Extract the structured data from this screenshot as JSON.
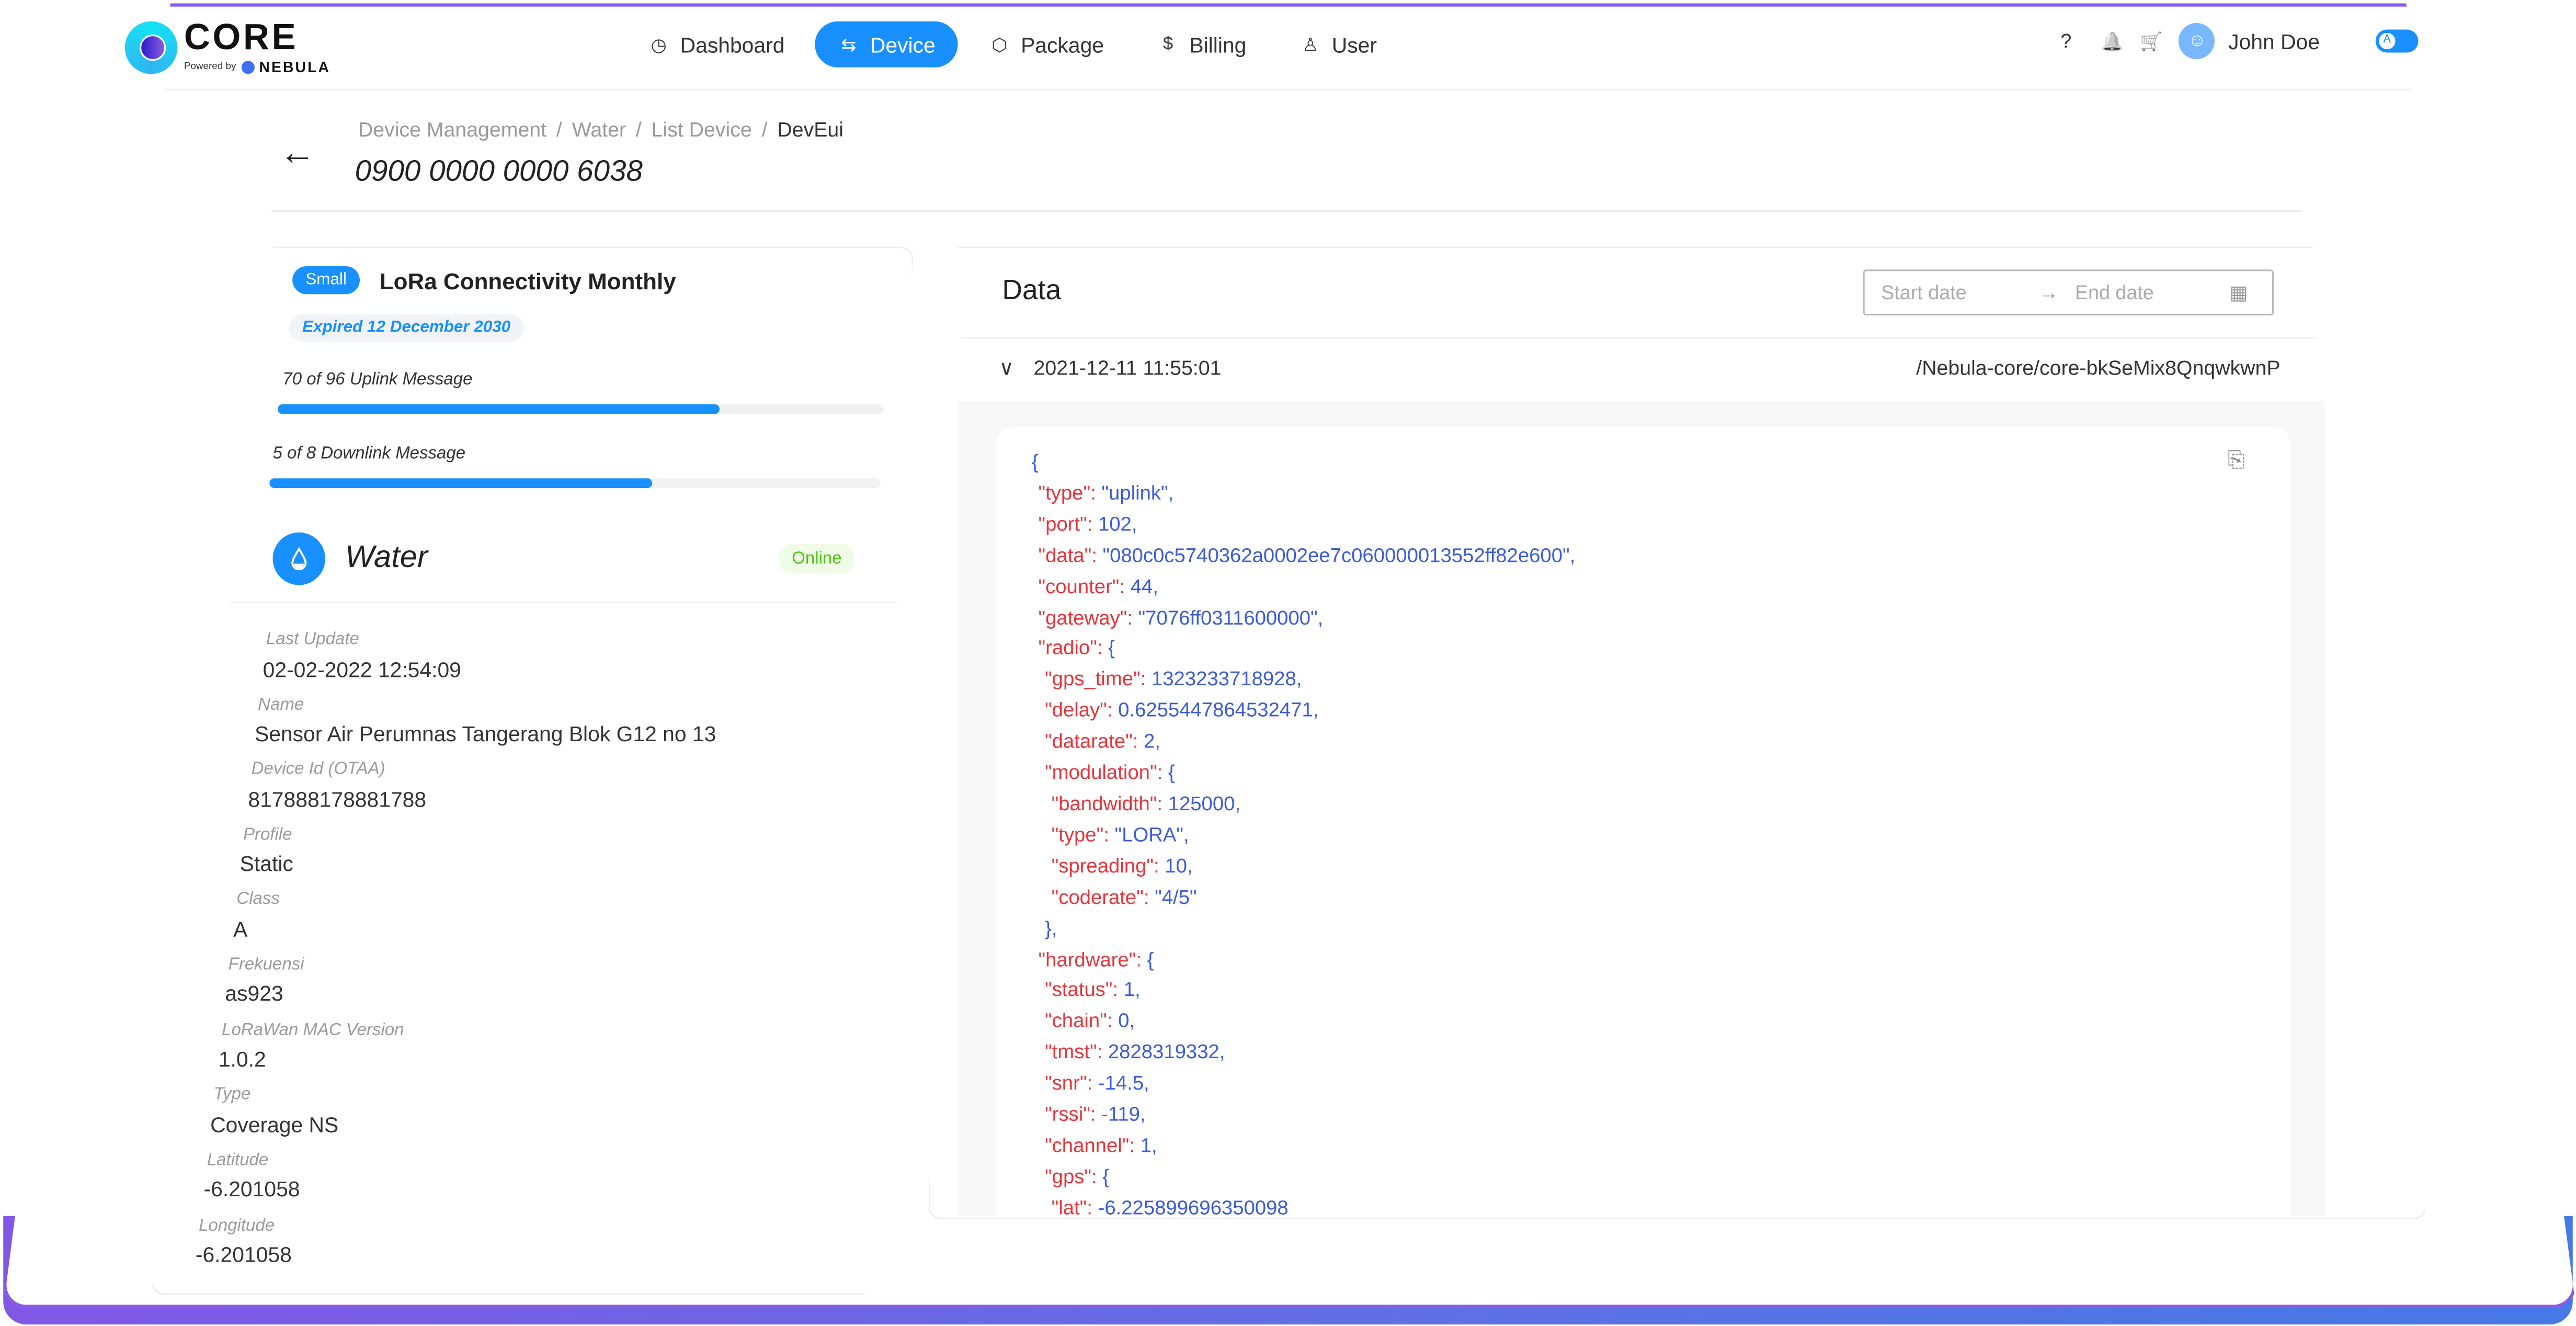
{
  "app": {
    "logo_title": "CORE",
    "logo_sub_prefix": "Powered by",
    "logo_sub_brand": "NEBULA"
  },
  "nav": {
    "items": [
      {
        "label": "Dashboard",
        "icon": "dashboard-icon",
        "glyph": "◷",
        "active": false
      },
      {
        "label": "Device",
        "icon": "device-icon",
        "glyph": "⇆",
        "active": true
      },
      {
        "label": "Package",
        "icon": "package-icon",
        "glyph": "⬡",
        "active": false
      },
      {
        "label": "Billing",
        "icon": "billing-icon",
        "glyph": "$",
        "active": false
      },
      {
        "label": "User",
        "icon": "user-icon",
        "glyph": "♙",
        "active": false
      }
    ]
  },
  "toolbar": {
    "help_glyph": "?",
    "bell_glyph": "🔔",
    "cart_glyph": "🛒",
    "user_name": "John Doe",
    "avatar_glyph": "☺",
    "language_toggle": "A"
  },
  "page": {
    "back_glyph": "←",
    "breadcrumb": [
      "Device Management",
      "Water",
      "List Device",
      "DevEui"
    ],
    "breadcrumb_sep": "/",
    "title": "0900 0000 0000 6038"
  },
  "package": {
    "size_badge": "Small",
    "name": "LoRa Connectivity Monthly",
    "expired": "Expired 12 December 2030",
    "uplink": {
      "label": "70 of 96 Uplink Message",
      "used": 70,
      "total": 96
    },
    "downlink": {
      "label": "5 of 8 Downlink Message",
      "used": 5,
      "total": 8
    }
  },
  "device": {
    "icon_glyph": "💧",
    "name": "Water",
    "status": "Online",
    "fields": [
      {
        "label": "Last Update",
        "value": "02-02-2022 12:54:09"
      },
      {
        "label": "Name",
        "value": "Sensor Air Perumnas Tangerang Blok G12 no 13"
      },
      {
        "label": "Device Id (OTAA)",
        "value": "817888178881788"
      },
      {
        "label": "Profile",
        "value": "Static"
      },
      {
        "label": "Class",
        "value": "A"
      },
      {
        "label": "Frekuensi",
        "value": "as923"
      },
      {
        "label": "LoRaWan MAC Version",
        "value": "1.0.2"
      },
      {
        "label": "Type",
        "value": "Coverage NS"
      },
      {
        "label": "Latitude",
        "value": "-6.201058"
      },
      {
        "label": "Longitude",
        "value": "-6.201058"
      }
    ]
  },
  "data_panel": {
    "title": "Data",
    "start_placeholder": "Start date",
    "end_placeholder": "End date",
    "range_arrow": "→",
    "calendar_glyph": "▦",
    "entry": {
      "expand_glyph": "∨",
      "timestamp": "2021-12-11 11:55:01",
      "path": "/Nebula-core/core-bkSeMix8QnqwkwnP"
    },
    "copy_glyph": "⎘",
    "payload_lines": [
      {
        "indent": 0,
        "key": "",
        "value": "{",
        "tail": ""
      },
      {
        "indent": 1,
        "key": "\"type\"",
        "value": "\"uplink\"",
        "tail": ","
      },
      {
        "indent": 1,
        "key": "\"port\"",
        "value": "102",
        "tail": ","
      },
      {
        "indent": 1,
        "key": "\"data\"",
        "value": "\"080c0c5740362a0002ee7c060000013552ff82e600\"",
        "tail": ","
      },
      {
        "indent": 1,
        "key": "\"counter\"",
        "value": "44",
        "tail": ","
      },
      {
        "indent": 1,
        "key": "\"gateway\"",
        "value": "\"7076ff0311600000\"",
        "tail": ","
      },
      {
        "indent": 1,
        "key": "\"radio\"",
        "value": "{",
        "tail": ""
      },
      {
        "indent": 2,
        "key": "\"gps_time\"",
        "value": "1323233718928",
        "tail": ","
      },
      {
        "indent": 2,
        "key": "\"delay\"",
        "value": "0.6255447864532471",
        "tail": ","
      },
      {
        "indent": 2,
        "key": "\"datarate\"",
        "value": "2",
        "tail": ","
      },
      {
        "indent": 2,
        "key": "\"modulation\"",
        "value": "{",
        "tail": ""
      },
      {
        "indent": 3,
        "key": "\"bandwidth\"",
        "value": "125000",
        "tail": ","
      },
      {
        "indent": 3,
        "key": "\"type\"",
        "value": "\"LORA\"",
        "tail": ","
      },
      {
        "indent": 3,
        "key": "\"spreading\"",
        "value": "10",
        "tail": ","
      },
      {
        "indent": 3,
        "key": "\"coderate\"",
        "value": "\"4/5\"",
        "tail": ""
      },
      {
        "indent": 2,
        "key": "",
        "value": "},",
        "tail": ""
      },
      {
        "indent": 1,
        "key": "\"hardware\"",
        "value": "{",
        "tail": ""
      },
      {
        "indent": 2,
        "key": "\"status\"",
        "value": "1",
        "tail": ","
      },
      {
        "indent": 2,
        "key": "\"chain\"",
        "value": "0",
        "tail": ","
      },
      {
        "indent": 2,
        "key": "\"tmst\"",
        "value": "2828319332",
        "tail": ","
      },
      {
        "indent": 2,
        "key": "\"snr\"",
        "value": "-14.5",
        "tail": ","
      },
      {
        "indent": 2,
        "key": "\"rssi\"",
        "value": "-119",
        "tail": ","
      },
      {
        "indent": 2,
        "key": "\"channel\"",
        "value": "1",
        "tail": ","
      },
      {
        "indent": 2,
        "key": "\"gps\"",
        "value": "{",
        "tail": ""
      },
      {
        "indent": 3,
        "key": "\"lat\"",
        "value": "-6.225899696350098",
        "tail": ""
      }
    ]
  },
  "colors": {
    "accent": "#1890ff",
    "json_key": "#e8333b",
    "json_value": "#3b5bdb",
    "online": "#52c41a",
    "frame_start": "#8157e6",
    "frame_end": "#4579e6"
  }
}
